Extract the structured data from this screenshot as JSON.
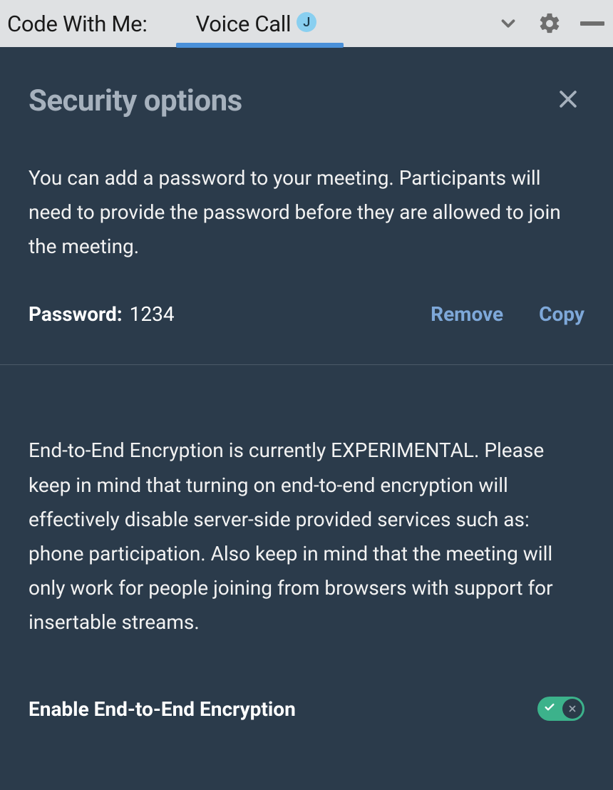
{
  "topbar": {
    "title": "Code With Me:",
    "tab_label": "Voice Call",
    "tab_badge": "J"
  },
  "panel": {
    "title": "Security options"
  },
  "password_section": {
    "description": "You can add a password to your meeting. Participants will need to provide the password before they are allowed to join the meeting.",
    "label": "Password:",
    "value": "1234",
    "remove_label": "Remove",
    "copy_label": "Copy"
  },
  "encryption_section": {
    "description": "End-to-End Encryption is currently EXPERIMENTAL. Please keep in mind that turning on end-to-end encryption will effectively disable server-side provided services such as: phone participation. Also keep in mind that the meeting will only work for people joining from browsers with support for insertable streams.",
    "toggle_label": "Enable End-to-End Encryption",
    "toggle_on": true
  }
}
